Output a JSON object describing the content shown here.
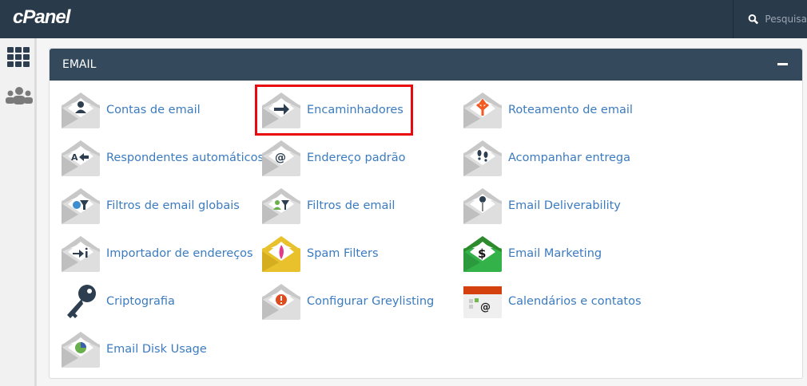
{
  "header": {
    "logo": "cPanel",
    "search_placeholder": "Pesquisa"
  },
  "sidebar": {
    "items": [
      {
        "icon": "grid-icon"
      },
      {
        "icon": "users-icon"
      }
    ]
  },
  "panel": {
    "title": "EMAIL"
  },
  "items": [
    {
      "label": "Contas de email",
      "icon": "user",
      "col": 0,
      "row": 0
    },
    {
      "label": "Encaminhadores",
      "icon": "arrow",
      "col": 1,
      "row": 0
    },
    {
      "label": "Roteamento de email",
      "icon": "route",
      "col": 2,
      "row": 0
    },
    {
      "label": "Respondentes automáticos",
      "icon": "reply",
      "col": 0,
      "row": 1
    },
    {
      "label": "Endereço padrão",
      "icon": "at",
      "col": 1,
      "row": 1
    },
    {
      "label": "Acompanhar entrega",
      "icon": "steps",
      "col": 2,
      "row": 1
    },
    {
      "label": "Filtros de email globais",
      "icon": "globefilter",
      "col": 0,
      "row": 2
    },
    {
      "label": "Filtros de email",
      "icon": "userfilter",
      "col": 1,
      "row": 2
    },
    {
      "label": "Email Deliverability",
      "icon": "key",
      "col": 2,
      "row": 2
    },
    {
      "label": "Importador de endereços",
      "icon": "import",
      "col": 0,
      "row": 3
    },
    {
      "label": "Spam Filters",
      "icon": "spam",
      "col": 1,
      "row": 3
    },
    {
      "label": "Email Marketing",
      "icon": "dollar",
      "col": 2,
      "row": 3
    },
    {
      "label": "Criptografia",
      "icon": "bigkey",
      "col": 0,
      "row": 4
    },
    {
      "label": "Configurar Greylisting",
      "icon": "grey",
      "col": 1,
      "row": 4
    },
    {
      "label": "Calendários e contatos",
      "icon": "calendar",
      "col": 2,
      "row": 4
    },
    {
      "label": "Email Disk Usage",
      "icon": "pie",
      "col": 0,
      "row": 5
    }
  ],
  "highlighted": "Encaminhadores",
  "colors": {
    "header": "#293a4a",
    "link": "#3b7bc0",
    "highlight": "#e8080d"
  }
}
